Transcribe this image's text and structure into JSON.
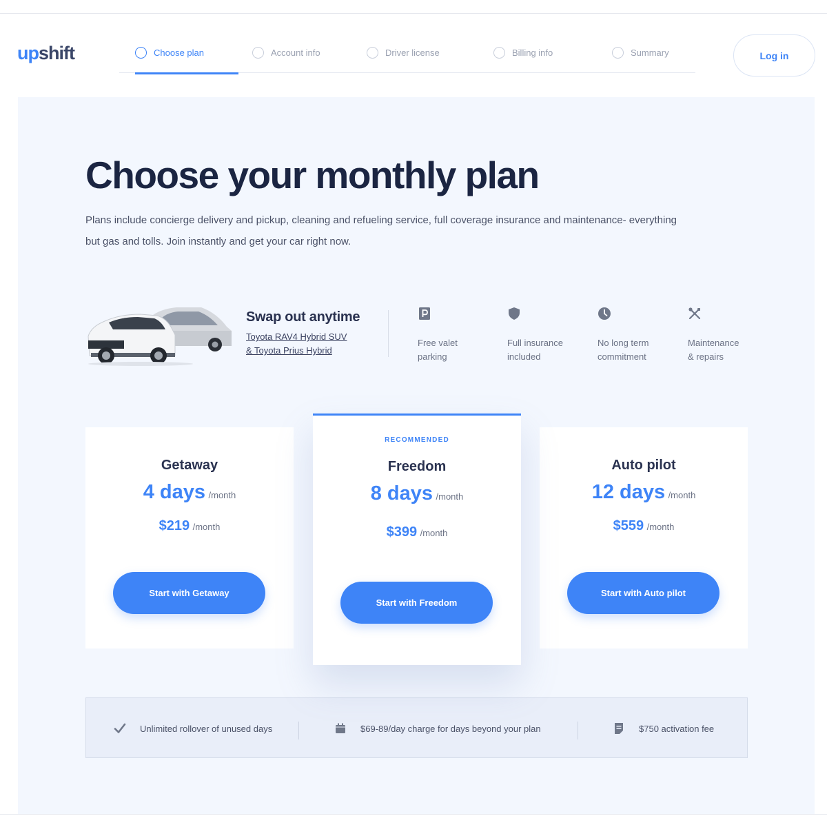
{
  "brand": {
    "logo_prefix": "up",
    "logo_suffix": "shift",
    "accent": "#3e84f7"
  },
  "steps": [
    {
      "label": "Choose plan",
      "active": true
    },
    {
      "label": "Account info",
      "active": false
    },
    {
      "label": "Driver license",
      "active": false
    },
    {
      "label": "Billing info",
      "active": false
    },
    {
      "label": "Summary",
      "active": false
    }
  ],
  "header": {
    "login_label": "Log in"
  },
  "hero": {
    "title": "Choose your monthly plan",
    "description": "Plans include concierge delivery and pickup, cleaning and refueling service, full coverage insurance and maintenance- everything but gas and tolls. Join instantly and get your car right now."
  },
  "vehicles": {
    "title": "Swap out anytime",
    "links": [
      "Toyota RAV4 Hybrid SUV",
      "& Toyota Prius Hybrid"
    ]
  },
  "features": [
    {
      "icon": "parking-icon",
      "line1": "Free valet",
      "line2": "parking"
    },
    {
      "icon": "shield-icon",
      "line1": "Full insurance",
      "line2": "included"
    },
    {
      "icon": "clock-icon",
      "line1": "No long term",
      "line2": "commitment"
    },
    {
      "icon": "tools-icon",
      "line1": "Maintenance",
      "line2": "& repairs"
    }
  ],
  "plans": [
    {
      "name": "Getaway",
      "days": "4 days",
      "days_unit": "/month",
      "price": "$219",
      "price_unit": "/month",
      "button": "Start with Getaway",
      "recommended": ""
    },
    {
      "name": "Freedom",
      "days": "8 days",
      "days_unit": "/month",
      "price": "$399",
      "price_unit": "/month",
      "button": "Start with Freedom",
      "recommended": "RECOMMENDED"
    },
    {
      "name": "Auto pilot",
      "days": "12 days",
      "days_unit": "/month",
      "price": "$559",
      "price_unit": "/month",
      "button": "Start with Auto pilot",
      "recommended": ""
    }
  ],
  "info": [
    {
      "icon": "checkmark-icon",
      "text": "Unlimited rollover of unused days"
    },
    {
      "icon": "calendar-icon",
      "text": "$69-89/day charge for days beyond your plan"
    },
    {
      "icon": "receipt-icon",
      "text": "$750 activation fee"
    }
  ]
}
